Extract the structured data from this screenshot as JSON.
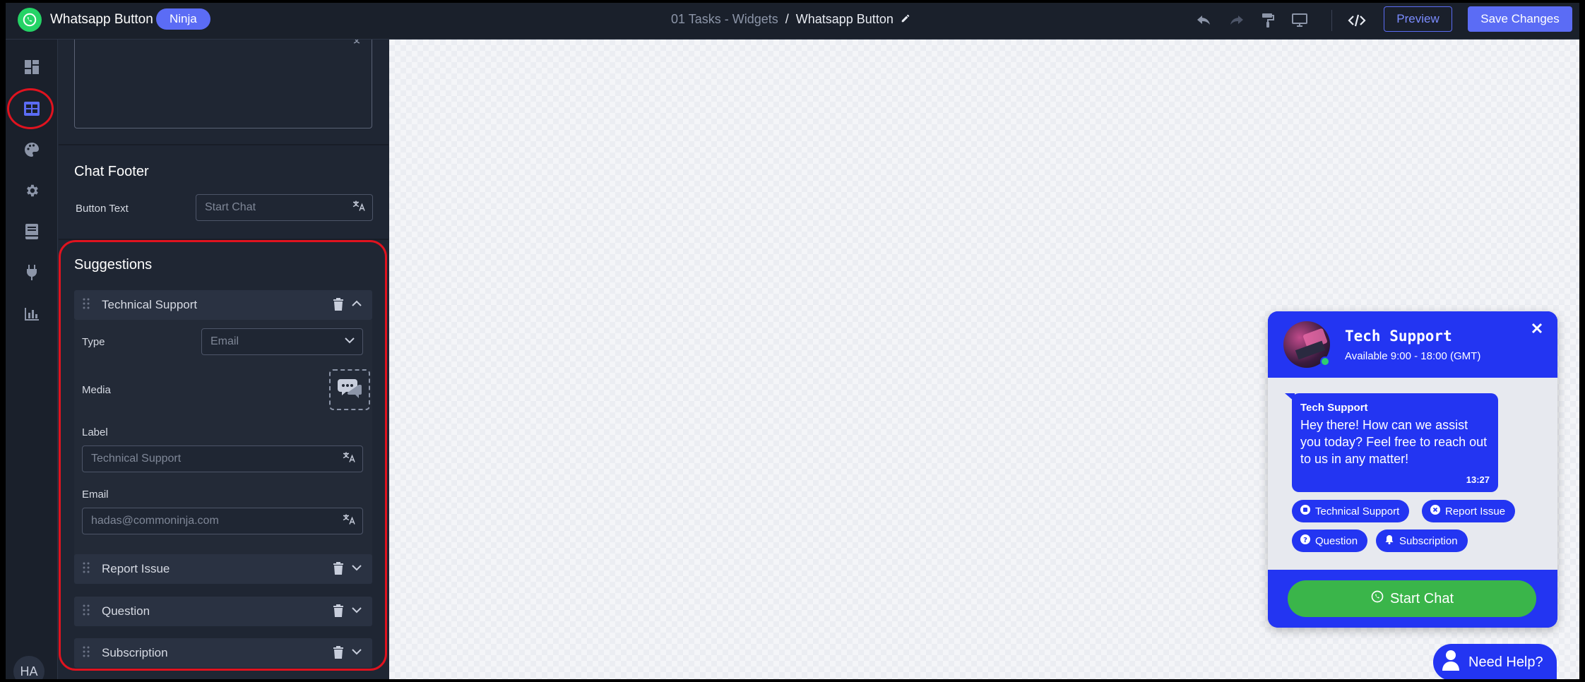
{
  "app": {
    "title": "Whatsapp Button",
    "badge": "Ninja"
  },
  "breadcrumb": {
    "parent": "01 Tasks - Widgets",
    "separator": "/",
    "current": "Whatsapp Button"
  },
  "toolbar": {
    "preview_label": "Preview",
    "save_label": "Save Changes"
  },
  "rail": {
    "user_initials": "HA",
    "items": [
      "dashboard-icon",
      "layout-icon",
      "palette-icon",
      "gear-icon",
      "book-icon",
      "plug-icon",
      "analytics-icon"
    ]
  },
  "chat_footer": {
    "section_title": "Chat Footer",
    "button_text_label": "Button Text",
    "button_text_value": "Start Chat"
  },
  "suggestions": {
    "section_title": "Suggestions",
    "items": [
      {
        "label": "Technical Support",
        "expanded": true,
        "type_label": "Type",
        "type_value": "Email",
        "media_label": "Media",
        "label_label": "Label",
        "label_value": "Technical Support",
        "email_label": "Email",
        "email_value": "hadas@commoninja.com"
      },
      {
        "label": "Report Issue",
        "expanded": false
      },
      {
        "label": "Question",
        "expanded": false
      },
      {
        "label": "Subscription",
        "expanded": false
      }
    ]
  },
  "widget": {
    "agent_name": "Tech Support",
    "availability": "Available 9:00 - 18:00 (GMT)",
    "message": {
      "sender": "Tech Support",
      "text": "Hey there! How can we assist you today? Feel free to reach out to us in any matter!",
      "time": "13:27"
    },
    "chips": [
      {
        "label": "Technical Support",
        "icon": "support-icon"
      },
      {
        "label": "Report Issue",
        "icon": "x-circle-icon"
      },
      {
        "label": "Question",
        "icon": "question-icon"
      },
      {
        "label": "Subscription",
        "icon": "bell-icon"
      }
    ],
    "start_button": "Start Chat",
    "help_button": "Need Help?"
  },
  "colors": {
    "accent": "#5b6cf5",
    "widget_blue": "#2335f2",
    "whatsapp_green": "#3ab54a",
    "highlight_red": "#e0131f"
  }
}
